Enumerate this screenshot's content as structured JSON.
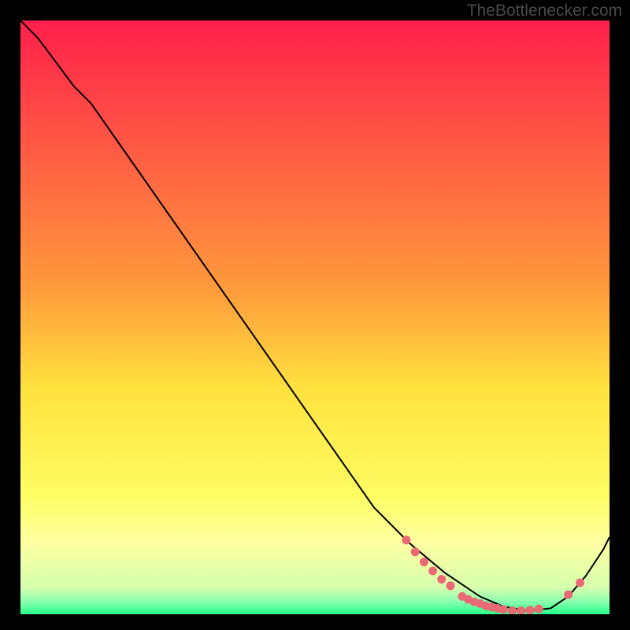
{
  "watermark": "TheBottlenecker.com",
  "chart_data": {
    "type": "line",
    "title": "",
    "xlabel": "",
    "ylabel": "",
    "xlim": [
      0,
      100
    ],
    "ylim": [
      0,
      100
    ],
    "gradient_stops": [
      {
        "offset": 0,
        "color": "#ff1f4b"
      },
      {
        "offset": 0.45,
        "color": "#ff9a3c"
      },
      {
        "offset": 0.62,
        "color": "#ffe23e"
      },
      {
        "offset": 0.8,
        "color": "#fffd63"
      },
      {
        "offset": 0.88,
        "color": "#fdffa1"
      },
      {
        "offset": 0.955,
        "color": "#d6ffad"
      },
      {
        "offset": 0.978,
        "color": "#8dffb0"
      },
      {
        "offset": 1.0,
        "color": "#25ff87"
      }
    ],
    "series": [
      {
        "name": "curve",
        "color": "#000000",
        "x": [
          0,
          3,
          6,
          9,
          12,
          60,
          66,
          72,
          78,
          82,
          86,
          90,
          93,
          96,
          99,
          100
        ],
        "y": [
          100,
          97,
          93,
          89,
          86,
          18,
          12,
          7,
          3,
          1.3,
          0.6,
          1.0,
          3.0,
          6.5,
          11,
          13
        ]
      }
    ],
    "markers": {
      "color": "#e96a74",
      "radius": 5.5,
      "points": [
        {
          "x": 65.5,
          "y": 12.5
        },
        {
          "x": 67.0,
          "y": 10.5
        },
        {
          "x": 68.5,
          "y": 8.8
        },
        {
          "x": 70.0,
          "y": 7.3
        },
        {
          "x": 71.5,
          "y": 5.9
        },
        {
          "x": 73.0,
          "y": 4.8
        },
        {
          "x": 75.0,
          "y": 3.0
        },
        {
          "x": 76.0,
          "y": 2.5
        },
        {
          "x": 77.0,
          "y": 2.1
        },
        {
          "x": 78.0,
          "y": 1.8
        },
        {
          "x": 79.0,
          "y": 1.4
        },
        {
          "x": 80.0,
          "y": 1.2
        },
        {
          "x": 81.0,
          "y": 1.0
        },
        {
          "x": 82.0,
          "y": 0.8
        },
        {
          "x": 83.5,
          "y": 0.6
        },
        {
          "x": 85.0,
          "y": 0.6
        },
        {
          "x": 86.5,
          "y": 0.7
        },
        {
          "x": 88.0,
          "y": 0.9
        },
        {
          "x": 93.0,
          "y": 3.3
        },
        {
          "x": 95.0,
          "y": 5.3
        }
      ]
    }
  }
}
